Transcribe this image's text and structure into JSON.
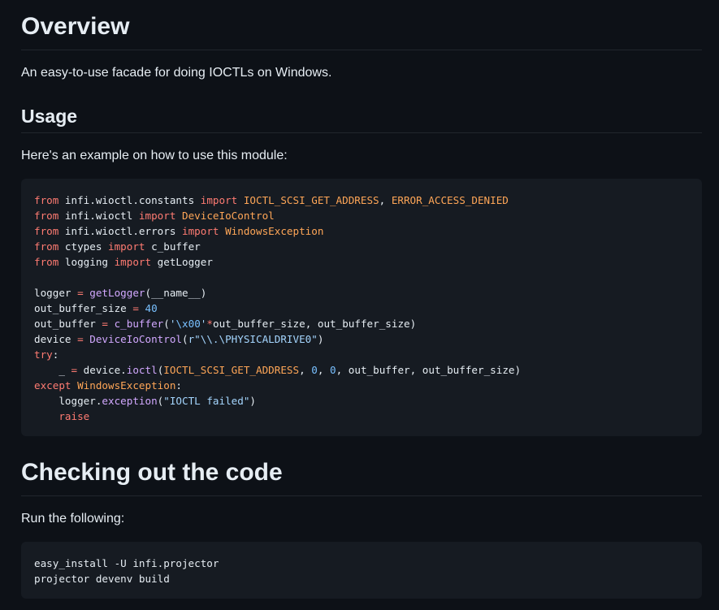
{
  "overview": {
    "heading": "Overview",
    "description": "An easy-to-use facade for doing IOCTLs on Windows."
  },
  "usage": {
    "heading": "Usage",
    "intro": "Here's an example on how to use this module:",
    "code_lines": [
      [
        {
          "t": "from",
          "c": "kw"
        },
        {
          "t": " infi.wioctl.constants ",
          "c": "plain"
        },
        {
          "t": "import",
          "c": "kw"
        },
        {
          "t": " ",
          "c": "plain"
        },
        {
          "t": "IOCTL_SCSI_GET_ADDRESS",
          "c": "cls"
        },
        {
          "t": ", ",
          "c": "plain"
        },
        {
          "t": "ERROR_ACCESS_DENIED",
          "c": "cls"
        }
      ],
      [
        {
          "t": "from",
          "c": "kw"
        },
        {
          "t": " infi.wioctl ",
          "c": "plain"
        },
        {
          "t": "import",
          "c": "kw"
        },
        {
          "t": " ",
          "c": "plain"
        },
        {
          "t": "DeviceIoControl",
          "c": "cls"
        }
      ],
      [
        {
          "t": "from",
          "c": "kw"
        },
        {
          "t": " infi.wioctl.errors ",
          "c": "plain"
        },
        {
          "t": "import",
          "c": "kw"
        },
        {
          "t": " ",
          "c": "plain"
        },
        {
          "t": "WindowsException",
          "c": "cls"
        }
      ],
      [
        {
          "t": "from",
          "c": "kw"
        },
        {
          "t": " ctypes ",
          "c": "plain"
        },
        {
          "t": "import",
          "c": "kw"
        },
        {
          "t": " c_buffer",
          "c": "plain"
        }
      ],
      [
        {
          "t": "from",
          "c": "kw"
        },
        {
          "t": " logging ",
          "c": "plain"
        },
        {
          "t": "import",
          "c": "kw"
        },
        {
          "t": " getLogger",
          "c": "plain"
        }
      ],
      [],
      [
        {
          "t": "logger ",
          "c": "plain"
        },
        {
          "t": "=",
          "c": "op"
        },
        {
          "t": " ",
          "c": "plain"
        },
        {
          "t": "getLogger",
          "c": "fn"
        },
        {
          "t": "(__name__)",
          "c": "plain"
        }
      ],
      [
        {
          "t": "out_buffer_size ",
          "c": "plain"
        },
        {
          "t": "=",
          "c": "op"
        },
        {
          "t": " ",
          "c": "plain"
        },
        {
          "t": "40",
          "c": "num"
        }
      ],
      [
        {
          "t": "out_buffer ",
          "c": "plain"
        },
        {
          "t": "=",
          "c": "op"
        },
        {
          "t": " ",
          "c": "plain"
        },
        {
          "t": "c_buffer",
          "c": "fn"
        },
        {
          "t": "(",
          "c": "plain"
        },
        {
          "t": "'",
          "c": "str"
        },
        {
          "t": "\\x00",
          "c": "esc"
        },
        {
          "t": "'",
          "c": "str"
        },
        {
          "t": "*",
          "c": "op"
        },
        {
          "t": "out_buffer_size, out_buffer_size)",
          "c": "plain"
        }
      ],
      [
        {
          "t": "device ",
          "c": "plain"
        },
        {
          "t": "=",
          "c": "op"
        },
        {
          "t": " ",
          "c": "plain"
        },
        {
          "t": "DeviceIoControl",
          "c": "fn"
        },
        {
          "t": "(",
          "c": "plain"
        },
        {
          "t": "r\"\\\\.\\PHYSICALDRIVE0\"",
          "c": "str"
        },
        {
          "t": ")",
          "c": "plain"
        }
      ],
      [
        {
          "t": "try",
          "c": "kw"
        },
        {
          "t": ":",
          "c": "plain"
        }
      ],
      [
        {
          "t": "    _ ",
          "c": "plain"
        },
        {
          "t": "=",
          "c": "op"
        },
        {
          "t": " device.",
          "c": "plain"
        },
        {
          "t": "ioctl",
          "c": "fn"
        },
        {
          "t": "(",
          "c": "plain"
        },
        {
          "t": "IOCTL_SCSI_GET_ADDRESS",
          "c": "cls"
        },
        {
          "t": ", ",
          "c": "plain"
        },
        {
          "t": "0",
          "c": "num"
        },
        {
          "t": ", ",
          "c": "plain"
        },
        {
          "t": "0",
          "c": "num"
        },
        {
          "t": ", out_buffer, out_buffer_size)",
          "c": "plain"
        }
      ],
      [
        {
          "t": "except",
          "c": "kw"
        },
        {
          "t": " ",
          "c": "plain"
        },
        {
          "t": "WindowsException",
          "c": "cls"
        },
        {
          "t": ":",
          "c": "plain"
        }
      ],
      [
        {
          "t": "    logger.",
          "c": "plain"
        },
        {
          "t": "exception",
          "c": "fn"
        },
        {
          "t": "(",
          "c": "plain"
        },
        {
          "t": "\"IOCTL failed\"",
          "c": "str"
        },
        {
          "t": ")",
          "c": "plain"
        }
      ],
      [
        {
          "t": "    ",
          "c": "plain"
        },
        {
          "t": "raise",
          "c": "kw"
        }
      ]
    ]
  },
  "checkout": {
    "heading": "Checking out the code",
    "intro": "Run the following:",
    "code_lines": [
      [
        {
          "t": "easy_install -U infi.projector",
          "c": "plain"
        }
      ],
      [
        {
          "t": "projector devenv build",
          "c": "plain"
        }
      ]
    ]
  },
  "colors": {
    "background": "#0d1117",
    "code_background": "#161b22",
    "text": "#e6edf3",
    "keyword": "#ff7b72",
    "class_name": "#ffa657",
    "function": "#d2a8ff",
    "number": "#79c0ff",
    "string": "#a5d6ff"
  }
}
